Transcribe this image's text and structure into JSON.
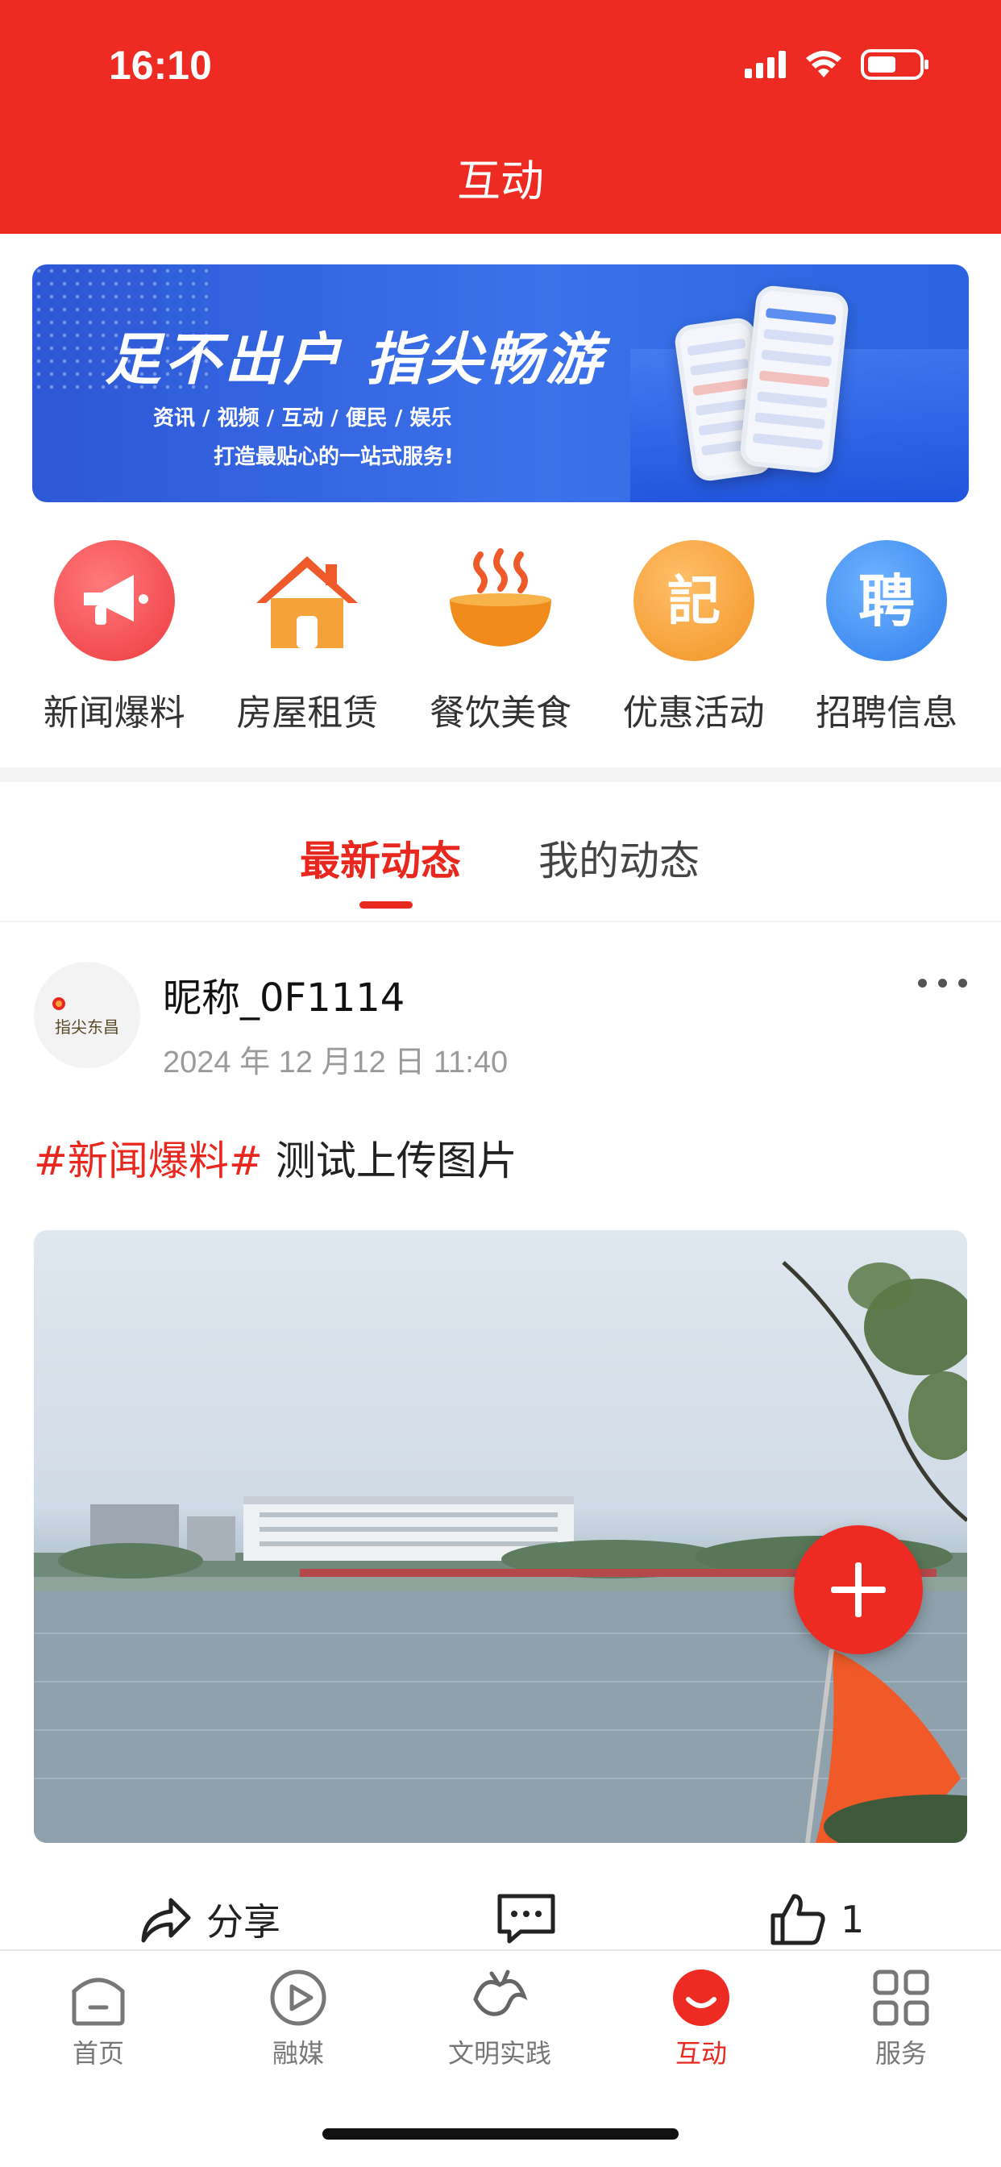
{
  "status_bar": {
    "time": "16:10"
  },
  "header": {
    "title": "互动"
  },
  "banner": {
    "headline": "足不出户  指尖畅游",
    "tags": "资讯 / 视频 / 互动 / 便民 / 娱乐",
    "subtitle": "打造最贴心的一站式服务!"
  },
  "grid": [
    {
      "label": "新闻爆料",
      "icon": "megaphone-icon",
      "color": "#f0484d"
    },
    {
      "label": "房屋租赁",
      "icon": "house-icon",
      "color": "#f39a2a"
    },
    {
      "label": "餐饮美食",
      "icon": "soup-bowl-icon",
      "color": "#f08a1a"
    },
    {
      "label": "优惠活动",
      "icon": "coupon-icon",
      "color": "#f6a23c",
      "glyph": "記"
    },
    {
      "label": "招聘信息",
      "icon": "recruit-icon",
      "color": "#3a8ef2",
      "glyph": "聘"
    }
  ],
  "tabs": {
    "latest": "最新动态",
    "mine": "我的动态"
  },
  "post": {
    "nickname": "昵称_0F1114",
    "time": "2024 年 12 月12 日 11:40",
    "hashtag": "#新闻爆料#",
    "text": " 测试上传图片",
    "avatar_text": "指尖东昌"
  },
  "actions": {
    "share": "分享",
    "like_count": "1"
  },
  "nav": {
    "home": "首页",
    "media": "融媒",
    "civic": "文明实践",
    "interact": "互动",
    "services": "服务"
  },
  "colors": {
    "brand_red": "#ee2b23",
    "active_red": "#e8281f"
  }
}
